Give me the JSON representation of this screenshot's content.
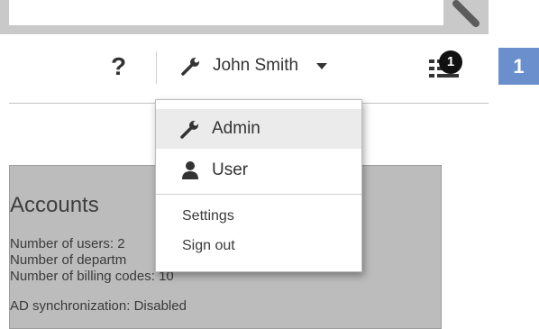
{
  "header": {
    "help_label": "?",
    "user_name": "John Smith",
    "queue_count": "1"
  },
  "step_badge": "1",
  "dropdown": {
    "items": [
      {
        "label": "Admin",
        "icon": "wrench-icon",
        "active": true
      },
      {
        "label": "User",
        "icon": "user-icon",
        "active": false
      }
    ],
    "links": [
      "Settings",
      "Sign out"
    ]
  },
  "accounts": {
    "title": "Accounts",
    "lines": [
      "Number of users: 2",
      "Number of departm",
      "Number of billing codes: 10",
      "AD synchronization: Disabled"
    ]
  },
  "colors": {
    "accent": "#6b8fcd",
    "panel_bg": "#bcbcbc",
    "active_item_bg": "#ebebeb"
  }
}
